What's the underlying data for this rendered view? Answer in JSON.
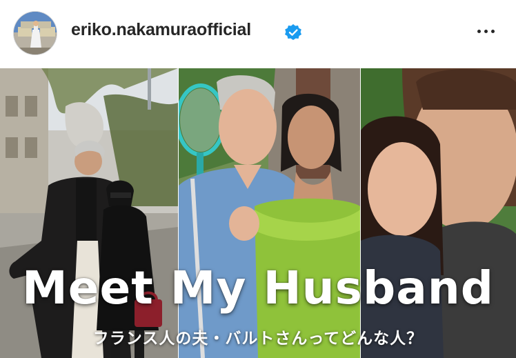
{
  "post": {
    "username": "eriko.nakamuraofficial",
    "verified_icon": "verified-badge-icon",
    "more_icon": "more-options-icon"
  },
  "thumbnail": {
    "title": "Meet My Husband",
    "subtitle": "フランス人の夫・バルトさんってどんな人？"
  },
  "colors": {
    "username": "#262626",
    "verified": "#1a9bf0",
    "title_text": "#ffffff"
  }
}
